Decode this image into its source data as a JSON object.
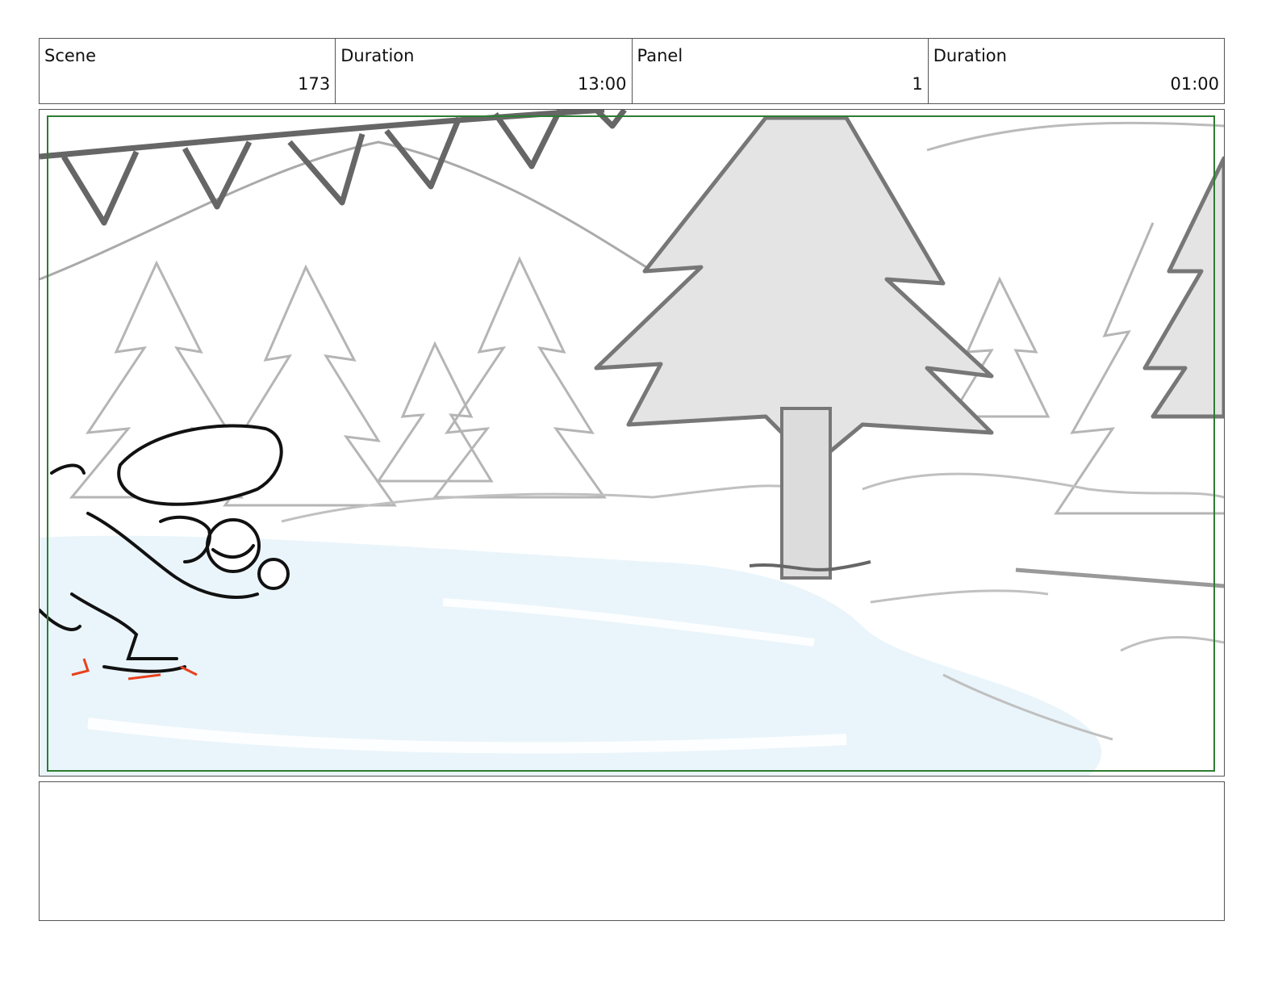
{
  "header": {
    "scene_label": "Scene",
    "scene_value": "173",
    "scene_duration_label": "Duration",
    "scene_duration_value": "13:00",
    "panel_label": "Panel",
    "panel_value": "1",
    "panel_duration_label": "Duration",
    "panel_duration_value": "01:00"
  },
  "panel_image": {
    "icon": "storyboard-sketch-winter-pond-skater",
    "frame_color": "#2e7d32",
    "ice_color": "#eaf5fb"
  },
  "notes": {
    "text": ""
  }
}
